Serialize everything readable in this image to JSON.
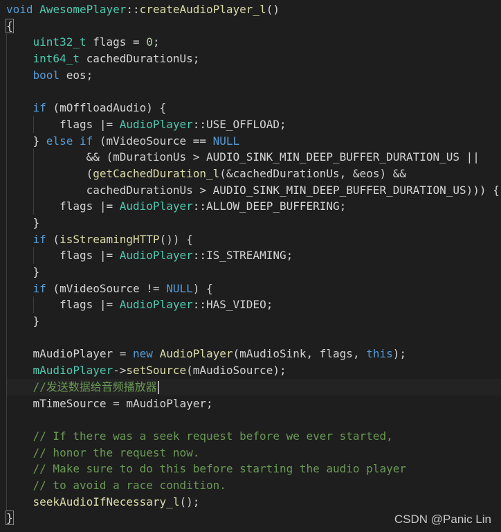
{
  "editor": {
    "theme": {
      "background": "#1e1e1e",
      "keyword": "#569cd6",
      "type": "#4ec9b0",
      "function": "#dcdcaa",
      "variable": "#9cdcfe",
      "number": "#b5cea8",
      "comment": "#6a9955",
      "text": "#d4d4d4"
    },
    "cursor_line": 24,
    "lines": [
      [
        {
          "t": "void",
          "c": "kw"
        },
        {
          "t": " "
        },
        {
          "t": "AwesomePlayer",
          "c": "ty"
        },
        {
          "t": "::"
        },
        {
          "t": "createAudioPlayer_l",
          "c": "fn"
        },
        {
          "t": "()"
        }
      ],
      [
        {
          "t": "{",
          "c": "brace"
        }
      ],
      [
        {
          "i": 4
        },
        {
          "t": "uint32_t",
          "c": "ty"
        },
        {
          "t": " flags = "
        },
        {
          "t": "0",
          "c": "nu"
        },
        {
          "t": ";"
        }
      ],
      [
        {
          "i": 4
        },
        {
          "t": "int64_t",
          "c": "ty"
        },
        {
          "t": " cachedDurationUs;"
        }
      ],
      [
        {
          "i": 4
        },
        {
          "t": "bool",
          "c": "kw"
        },
        {
          "t": " eos;"
        }
      ],
      [],
      [
        {
          "i": 4
        },
        {
          "t": "if",
          "c": "kw"
        },
        {
          "t": " (mOffloadAudio) {"
        }
      ],
      [
        {
          "i": 8
        },
        {
          "t": "flags |= "
        },
        {
          "t": "AudioPlayer",
          "c": "ty"
        },
        {
          "t": "::USE_OFFLOAD;"
        }
      ],
      [
        {
          "i": 4
        },
        {
          "t": "} "
        },
        {
          "t": "else",
          "c": "kw"
        },
        {
          "t": " "
        },
        {
          "t": "if",
          "c": "kw"
        },
        {
          "t": " (mVideoSource == "
        },
        {
          "t": "NULL",
          "c": "kw"
        }
      ],
      [
        {
          "i": 12
        },
        {
          "t": "&& (mDurationUs > AUDIO_SINK_MIN_DEEP_BUFFER_DURATION_US ||"
        }
      ],
      [
        {
          "i": 12
        },
        {
          "t": "("
        },
        {
          "t": "getCachedDuration_l",
          "c": "fn"
        },
        {
          "t": "(&cachedDurationUs, &eos) &&"
        }
      ],
      [
        {
          "i": 12
        },
        {
          "t": "cachedDurationUs > AUDIO_SINK_MIN_DEEP_BUFFER_DURATION_US))) {"
        }
      ],
      [
        {
          "i": 8
        },
        {
          "t": "flags |= "
        },
        {
          "t": "AudioPlayer",
          "c": "ty"
        },
        {
          "t": "::ALLOW_DEEP_BUFFERING;"
        }
      ],
      [
        {
          "i": 4
        },
        {
          "t": "}"
        }
      ],
      [
        {
          "i": 4
        },
        {
          "t": "if",
          "c": "kw"
        },
        {
          "t": " ("
        },
        {
          "t": "isStreamingHTTP",
          "c": "fn"
        },
        {
          "t": "()) {"
        }
      ],
      [
        {
          "i": 8
        },
        {
          "t": "flags |= "
        },
        {
          "t": "AudioPlayer",
          "c": "ty"
        },
        {
          "t": "::IS_STREAMING;"
        }
      ],
      [
        {
          "i": 4
        },
        {
          "t": "}"
        }
      ],
      [
        {
          "i": 4
        },
        {
          "t": "if",
          "c": "kw"
        },
        {
          "t": " (mVideoSource != "
        },
        {
          "t": "NULL",
          "c": "kw"
        },
        {
          "t": ") {"
        }
      ],
      [
        {
          "i": 8
        },
        {
          "t": "flags |= "
        },
        {
          "t": "AudioPlayer",
          "c": "ty"
        },
        {
          "t": "::HAS_VIDEO;"
        }
      ],
      [
        {
          "i": 4
        },
        {
          "t": "}"
        }
      ],
      [],
      [
        {
          "i": 4
        },
        {
          "t": "mAudioPlayer = "
        },
        {
          "t": "new",
          "c": "kw"
        },
        {
          "t": " "
        },
        {
          "t": "AudioPlayer",
          "c": "fn"
        },
        {
          "t": "(mAudioSink, flags, "
        },
        {
          "t": "this",
          "c": "kw"
        },
        {
          "t": ");"
        }
      ],
      [
        {
          "i": 4
        },
        {
          "t": "mAudioPlayer",
          "c": "ty"
        },
        {
          "t": "->"
        },
        {
          "t": "setSource",
          "c": "fn"
        },
        {
          "t": "(mAudioSource);"
        }
      ],
      [
        {
          "i": 4
        },
        {
          "t": "//发送数据给音频播放器",
          "c": "cm"
        }
      ],
      [
        {
          "i": 4
        },
        {
          "t": "mTimeSource = mAudioPlayer;"
        }
      ],
      [],
      [
        {
          "i": 4
        },
        {
          "t": "// If there was a seek request before we ever started,",
          "c": "cm"
        }
      ],
      [
        {
          "i": 4
        },
        {
          "t": "// honor the request now.",
          "c": "cm"
        }
      ],
      [
        {
          "i": 4
        },
        {
          "t": "// Make sure to do this before starting the audio player",
          "c": "cm"
        }
      ],
      [
        {
          "i": 4
        },
        {
          "t": "// to avoid a race condition.",
          "c": "cm"
        }
      ],
      [
        {
          "i": 4
        },
        {
          "t": "seekAudioIfNecessary_l",
          "c": "fn"
        },
        {
          "t": "();"
        }
      ],
      [
        {
          "t": "}",
          "c": "brace"
        }
      ]
    ]
  },
  "watermark": "CSDN @Panic  Lin"
}
